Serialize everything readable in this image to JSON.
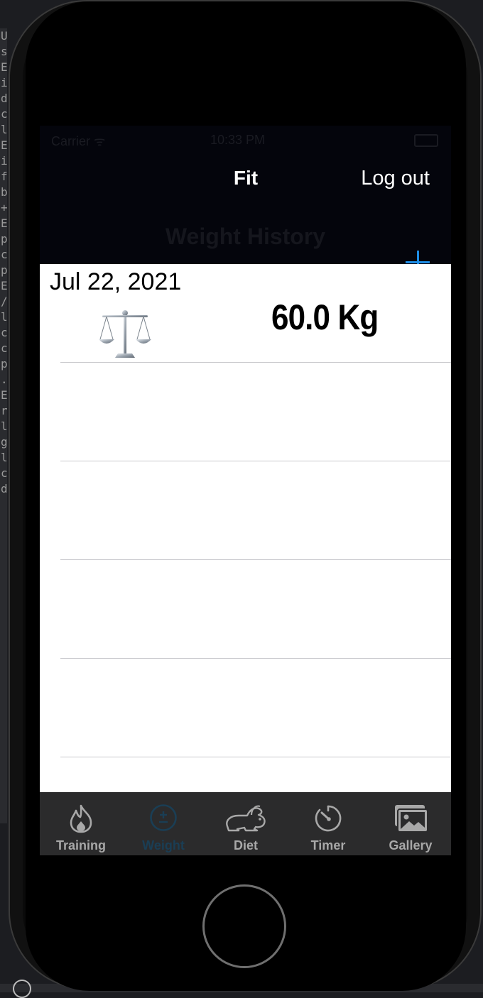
{
  "background_code": [
    "U",
    "s",
    "E",
    "i",
    "d",
    "c",
    "l",
    "E",
    "i",
    "f",
    "b",
    "+",
    "E",
    "p",
    "c",
    "p",
    "E",
    "/",
    "l",
    "c",
    "c",
    "p",
    ".",
    "E",
    "r",
    "l",
    "g",
    "l",
    "c",
    "d"
  ],
  "status_bar": {
    "carrier": "Carrier ᯤ",
    "time": "10:33 PM"
  },
  "nav": {
    "app_title": "Fit",
    "logout_label": "Log out",
    "large_title": "Weight History",
    "add_label": "+"
  },
  "entries": [
    {
      "date": "Jul 22, 2021",
      "weight": "60.0 Kg",
      "icon": "balance-scale-icon"
    }
  ],
  "tabs": [
    {
      "label": "Training",
      "icon": "flame-icon",
      "active": false
    },
    {
      "label": "Weight",
      "icon": "plus-minus-circle-icon",
      "active": true
    },
    {
      "label": "Diet",
      "icon": "rabbit-icon",
      "active": false
    },
    {
      "label": "Timer",
      "icon": "timer-icon",
      "active": false
    },
    {
      "label": "Gallery",
      "icon": "photos-icon",
      "active": false
    }
  ],
  "colors": {
    "accent": "#1d8de6",
    "active_tab": "#1a3e55",
    "inactive_tab": "#a8a8a8",
    "nav_background": "#04050c"
  }
}
